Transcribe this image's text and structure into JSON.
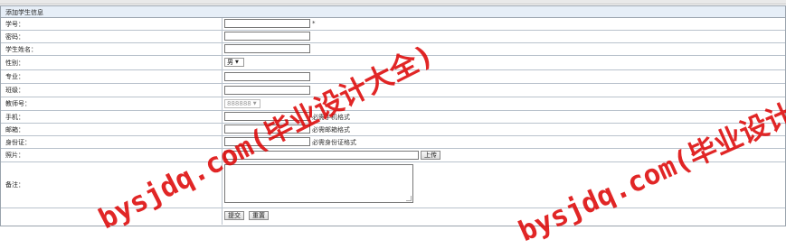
{
  "title": "添加学生信息",
  "fields": {
    "student_no": {
      "label": "学号：",
      "required": "*"
    },
    "password": {
      "label": "密码："
    },
    "student_name": {
      "label": "学生姓名："
    },
    "gender": {
      "label": "性别：",
      "value": "男"
    },
    "major": {
      "label": "专业："
    },
    "class": {
      "label": "班级："
    },
    "teacher_no": {
      "label": "教师号：",
      "value": "888888"
    },
    "phone": {
      "label": "手机：",
      "hint": "必需手机格式"
    },
    "email": {
      "label": "邮箱：",
      "hint": "必需邮箱格式"
    },
    "id_card": {
      "label": "身份证：",
      "hint": "必需身份证格式"
    },
    "photo": {
      "label": "照片：",
      "upload": "上传"
    },
    "remark": {
      "label": "备注："
    }
  },
  "actions": {
    "submit": "提交",
    "reset": "重置"
  },
  "watermarks": [
    {
      "text": "bysjdq.com(毕业设计大全)"
    },
    {
      "text": "bysjdq.com(毕业设计大全)"
    }
  ]
}
